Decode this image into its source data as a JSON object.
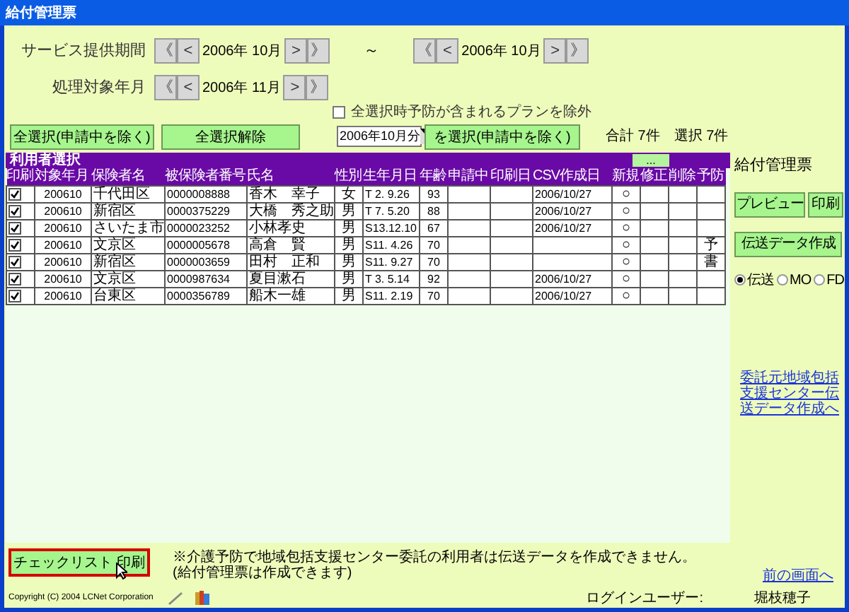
{
  "window": {
    "title": "給付管理票"
  },
  "service_period": {
    "label": "サービス提供期間",
    "separator": "～",
    "start": {
      "value": "2006年 10月",
      "buttons": [
        "《",
        "<",
        ">",
        "》"
      ]
    },
    "end": {
      "value": "2006年 10月",
      "buttons": [
        "《",
        "<",
        ">",
        "》"
      ]
    }
  },
  "processing_month": {
    "label": "処理対象年月",
    "picker": {
      "value": "2006年 11月",
      "buttons": [
        "《",
        "<",
        ">",
        "》"
      ]
    }
  },
  "exclude_option": {
    "label": "全選択時予防が含まれるプランを除外",
    "checked": false
  },
  "select_buttons": [
    "全選択(申請中を除く)",
    "全選択解除"
  ],
  "month_select": {
    "value": "2006年10月分",
    "button": "を選択(申請中を除く)"
  },
  "totals": {
    "total": "合計 7件",
    "selected": "選択 7件"
  },
  "user_list": {
    "title": "利用者選択",
    "more_button": "...",
    "columns": [
      "印刷",
      "対象年月",
      "保険者名",
      "被保険者番号",
      "氏名",
      "性別",
      "生年月日",
      "年齢",
      "申請中",
      "印刷日",
      "CSV作成日",
      "新規",
      "修正",
      "削除",
      "予防"
    ],
    "rows": [
      {
        "checked": true,
        "cells": [
          "",
          "200610",
          "千代田区",
          "0000008888",
          "香木　幸子",
          "女",
          "T 2. 9.26",
          "93",
          "",
          "",
          "2006/10/27",
          "○",
          "",
          "",
          ""
        ]
      },
      {
        "checked": true,
        "cells": [
          "",
          "200610",
          "新宿区",
          "0000375229",
          "大橋　秀之助",
          "男",
          "T 7. 5.20",
          "88",
          "",
          "",
          "2006/10/27",
          "○",
          "",
          "",
          ""
        ]
      },
      {
        "checked": true,
        "cells": [
          "",
          "200610",
          "さいたま市",
          "0000023252",
          "小林孝史",
          "男",
          "S13.12.10",
          "67",
          "",
          "",
          "2006/10/27",
          "○",
          "",
          "",
          ""
        ]
      },
      {
        "checked": true,
        "cells": [
          "",
          "200610",
          "文京区",
          "0000005678",
          "高倉　賢",
          "男",
          "S11. 4.26",
          "70",
          "",
          "",
          "",
          "○",
          "",
          "",
          "予"
        ]
      },
      {
        "checked": true,
        "cells": [
          "",
          "200610",
          "新宿区",
          "0000003659",
          "田村　正和",
          "男",
          "S11. 9.27",
          "70",
          "",
          "",
          "",
          "○",
          "",
          "",
          "書"
        ]
      },
      {
        "checked": true,
        "cells": [
          "",
          "200610",
          "文京区",
          "0000987634",
          "夏目漱石",
          "男",
          "T 3. 5.14",
          "92",
          "",
          "",
          "2006/10/27",
          "○",
          "",
          "",
          ""
        ]
      },
      {
        "checked": true,
        "cells": [
          "",
          "200610",
          "台東区",
          "0000356789",
          "船木一雄",
          "男",
          "S11. 2.19",
          "70",
          "",
          "",
          "2006/10/27",
          "○",
          "",
          "",
          ""
        ]
      }
    ]
  },
  "side_panel": {
    "title": "給付管理票",
    "buttons": [
      "プレビュー",
      "印刷"
    ],
    "transmit_button": "伝送データ作成",
    "media": [
      {
        "label": "伝送",
        "selected": true
      },
      {
        "label": "MO",
        "selected": false
      },
      {
        "label": "FD",
        "selected": false
      }
    ],
    "link": "委託元地域包括支援センター伝送データ作成へ"
  },
  "checklist_button": {
    "label": "チェックリスト 印刷",
    "focused": true
  },
  "note": "※介護予防で地域包括支援センター委託の利用者は伝送データを作成できません。(給付管理票は作成できます)",
  "back_link": "前の画面へ",
  "footer": {
    "copyright": "Copyright (C) 2004 LCNet Corporation",
    "login_label": "ログインユーザー:",
    "user": "堀枝穂子"
  }
}
